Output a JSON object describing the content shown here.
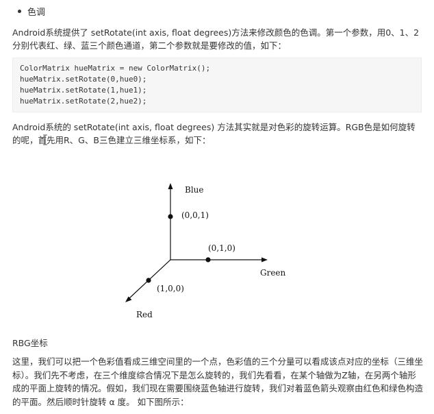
{
  "section": {
    "bullet_label": "色调"
  },
  "paragraphs": {
    "intro": "Android系统提供了 setRotate(int axis, float degrees)方法来修改颜色的色调。第一个参数，用0、1、2分别代表红、绿、蓝三个颜色通道，第二个参数就是要修改的值，如下：",
    "rotate_explain": "Android系统的 setRotate(int axis, float degrees) 方法其实就是对色彩的旋转运算。RGB色是如何旋转的呢，首先用R、G、B三色建立三维坐标系，如下：",
    "caption": "RBG坐标",
    "body": "这里，我们可以把一个色彩值看成三维空间里的一个点，色彩值的三个分量可以看成该点对应的坐标（三维坐标）。我们先不考虑，在三个维度综合情况下是怎么旋转的，我们先看看，在某个轴做为Z轴，在另两个轴形成的平面上旋转的情况。假如，我们现在需要围绕蓝色轴进行旋转，我们对着蓝色箭头观察由红色和绿色构造的平面。然后顺时针旋转 α 度。 如下图所示："
  },
  "code": {
    "lines": [
      "ColorMatrix hueMatrix = new ColorMatrix();",
      "hueMatrix.setRotate(0,hue0);",
      "hueMatrix.setRotate(1,hue1);",
      "hueMatrix.setRotate(2,hue2);"
    ]
  },
  "diagram": {
    "axis_blue": "Blue",
    "axis_green": "Green",
    "axis_red": "Red",
    "point_blue": "(0,0,1)",
    "point_green": "(0,1,0)",
    "point_red": "(1,0,0)"
  }
}
